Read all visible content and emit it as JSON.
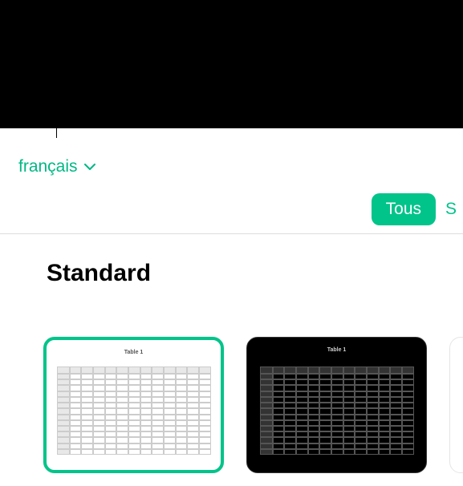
{
  "language": {
    "label": "français"
  },
  "filters": {
    "all_label": "Tous",
    "next_partial": "S"
  },
  "section": {
    "heading": "Standard"
  },
  "templates": [
    {
      "title": "Table 1",
      "variant": "light",
      "selected": true
    },
    {
      "title": "Table 1",
      "variant": "dark",
      "selected": false
    }
  ],
  "colors": {
    "accent": "#00c48a"
  }
}
